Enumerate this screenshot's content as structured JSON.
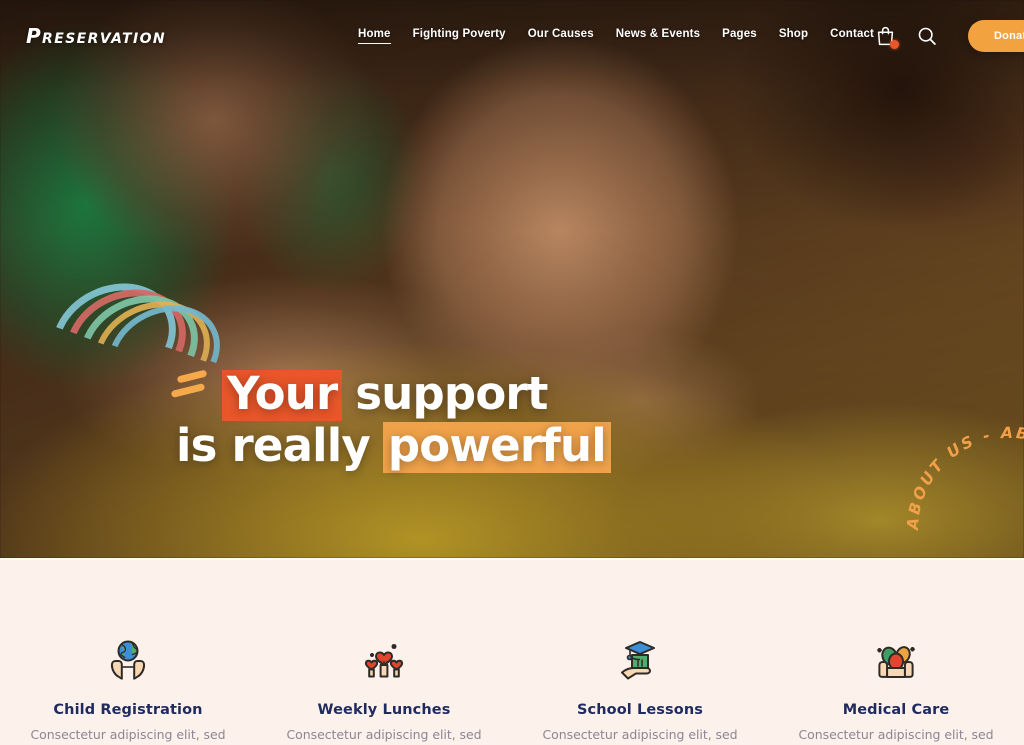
{
  "site": {
    "logo": "Preservation"
  },
  "nav": {
    "items": [
      {
        "label": "Home",
        "active": true
      },
      {
        "label": "Fighting Poverty",
        "active": false
      },
      {
        "label": "Our Causes",
        "active": false
      },
      {
        "label": "News & Events",
        "active": false
      },
      {
        "label": "Pages",
        "active": false
      },
      {
        "label": "Shop",
        "active": false
      },
      {
        "label": "Contact",
        "active": false
      }
    ]
  },
  "header_actions": {
    "cart_icon": "shopping-bag-icon",
    "cart_badge": "",
    "search_icon": "search-icon",
    "donate_label": "Donate"
  },
  "hero": {
    "line1_plain_a": "",
    "line1_highlight": "Your",
    "line1_plain_b": " support",
    "line2_plain_a": "is really ",
    "line2_highlight": "powerful",
    "badge_text": "ABOUT US  -  ABOUT US  -  ABOUT US  -  ",
    "image_alt": "Smiling children looking at camera"
  },
  "services": {
    "cards": [
      {
        "icon": "hands-holding-globe-icon",
        "title": "Child Registration",
        "desc": "Consectetur adipiscing elit, sed"
      },
      {
        "icon": "hands-holding-hearts-icon",
        "title": "Weekly Lunches",
        "desc": "Consectetur adipiscing elit, sed"
      },
      {
        "icon": "hand-holding-graduation-book-icon",
        "title": "School Lessons",
        "desc": "Consectetur adipiscing elit, sed"
      },
      {
        "icon": "hands-holding-medicine-icon",
        "title": "Medical Care",
        "desc": "Consectetur adipiscing elit, sed"
      }
    ]
  },
  "colors": {
    "accent_orange": "#f2a23e",
    "accent_red": "#e8562a",
    "highlight_orange": "#f0a24a",
    "section_bg": "#fdf1ec",
    "heading_navy": "#1f2b5e",
    "body_grey": "#8b8693"
  }
}
